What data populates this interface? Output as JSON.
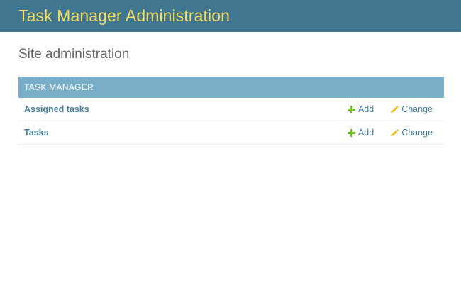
{
  "header": {
    "branding": "Task Manager Administration"
  },
  "page": {
    "title": "Site administration"
  },
  "modules": [
    {
      "caption": "TASK MANAGER",
      "models": [
        {
          "name": "Assigned tasks",
          "add_label": "Add",
          "change_label": "Change"
        },
        {
          "name": "Tasks",
          "add_label": "Add",
          "change_label": "Change"
        }
      ]
    }
  ],
  "colors": {
    "header_bg": "#417690",
    "branding": "#f5dd5d",
    "caption_bg": "#79aec8",
    "link": "#447e9b",
    "add_icon": "#70bf2b",
    "change_icon": "#efb80b"
  },
  "icons": {
    "add": "plus-icon",
    "change": "pencil-icon"
  }
}
